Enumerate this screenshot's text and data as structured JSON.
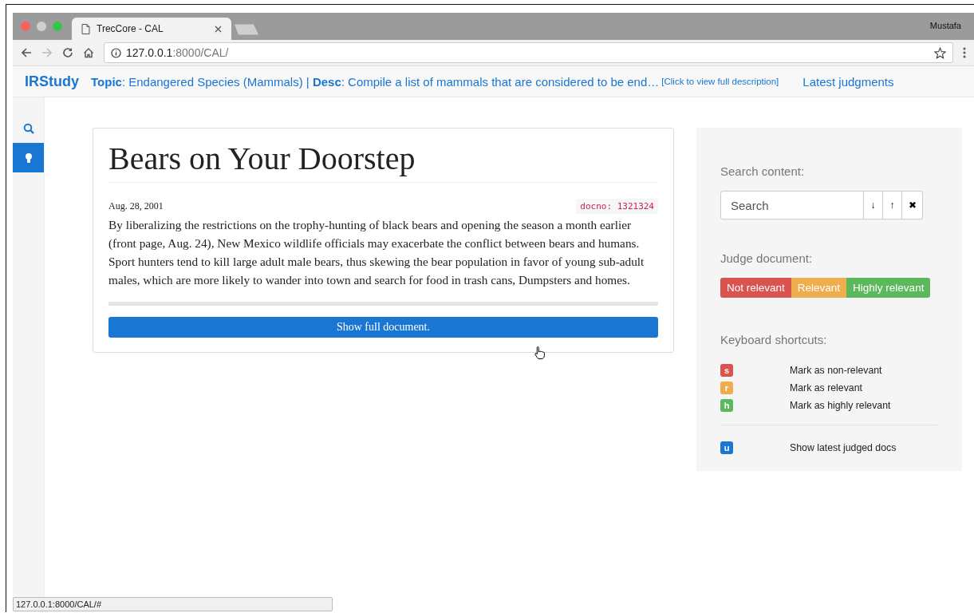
{
  "window": {
    "tab_title": "TrecCore - CAL",
    "profile": "Mustafa",
    "url_host": "127.0.0.1",
    "url_path": ":8000/CAL/"
  },
  "navbar": {
    "brand": "IRStudy",
    "topic": "**Topic**: Endangered Species (Mammals) | **Desc**: Compile a list of mammals that are considered to be end…",
    "desc_link": "[Click to view full description]",
    "latest": "Latest judgments"
  },
  "sidebar": {
    "items": [
      {
        "kind": "search",
        "selected": false
      },
      {
        "kind": "bulb",
        "selected": true
      }
    ]
  },
  "document": {
    "title": "Bears on Your Doorstep",
    "date": "Aug. 28, 2001",
    "docno": "docno: 1321324",
    "body": "By liberalizing the restrictions on the trophy-hunting of black bears and opening the season a month earlier (front page, Aug. 24), New Mexico wildlife officials may exacerbate the conflict between bears and humans. Sport hunters tend to kill large adult male bears, thus skewing the bear population in favor of young sub-adult males, which are more likely to wander into town and search for food in trash cans, Dumpsters and homes.",
    "button": "Show full document."
  },
  "panel": {
    "search_heading": "Search content:",
    "search_placeholder": "Search",
    "search_buttons": [
      "↓",
      "↑",
      "✖"
    ],
    "judge_heading": "Judge document:",
    "judge_buttons": [
      {
        "label": "Not relevant",
        "color": "#d9534f"
      },
      {
        "label": "Relevant",
        "color": "#f0ad4e"
      },
      {
        "label": "Highly relevant",
        "color": "#5cb85c"
      }
    ],
    "shortcuts_heading": "Keyboard shortcuts:",
    "shortcuts": [
      {
        "key": "s",
        "label": "Mark as non-relevant",
        "color": "#d9534f"
      },
      {
        "key": "r",
        "label": "Mark as relevant",
        "color": "#f0ad4e"
      },
      {
        "key": "h",
        "label": "Mark as highly relevant",
        "color": "#5cb85c"
      }
    ],
    "extra_shortcuts": [
      {
        "key": "u",
        "label": "Show latest judged docs",
        "color": "#1976d2"
      }
    ]
  },
  "status_bar": "127.0.0.1:8000/CAL/#"
}
